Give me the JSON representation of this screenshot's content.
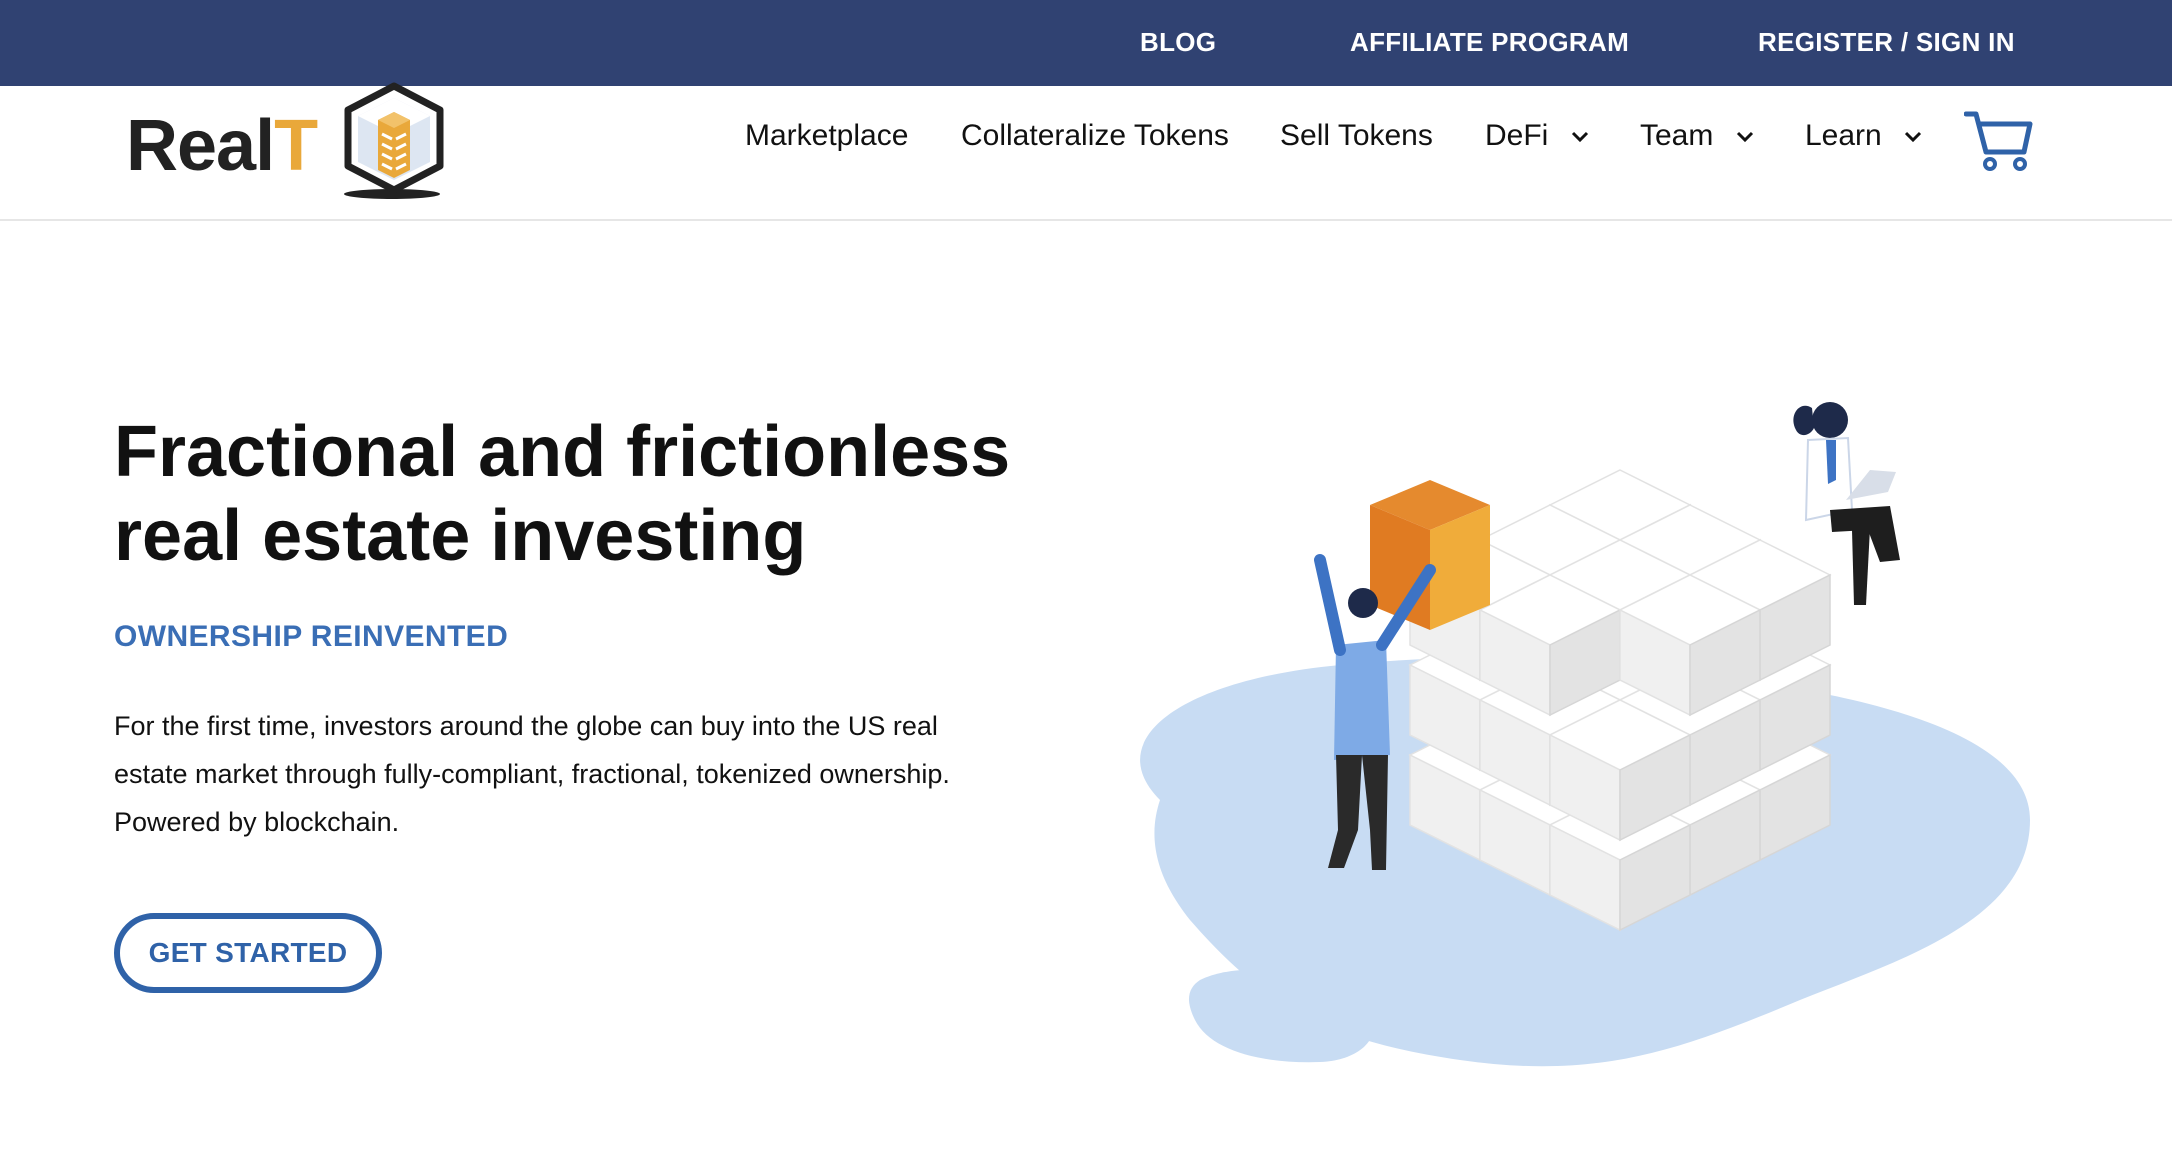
{
  "topbar": {
    "blog": "BLOG",
    "affiliate": "AFFILIATE PROGRAM",
    "register": "REGISTER / SIGN IN"
  },
  "logo": {
    "part1": "Real",
    "part2": "T"
  },
  "nav": {
    "marketplace": "Marketplace",
    "collateralize": "Collateralize Tokens",
    "sell": "Sell Tokens",
    "defi": "DeFi",
    "team": "Team",
    "learn": "Learn"
  },
  "icons": {
    "cart": "cart-icon",
    "chevron": "chevron-down-icon"
  },
  "hero": {
    "title_line1": "Fractional and frictionless",
    "title_line2": "real estate investing",
    "subtitle": "OWNERSHIP REINVENTED",
    "description_line1": "For the first time, investors around the globe can buy into the US real",
    "description_line2": "estate market through fully-compliant, fractional, tokenized ownership.",
    "description_line3": "Powered by blockchain.",
    "cta": "GET STARTED"
  },
  "colors": {
    "topbar_bg": "#304272",
    "accent_blue": "#2f62a8",
    "subtitle_blue": "#3a6eb5",
    "logo_gold": "#e9a83a",
    "blob_blue": "#c8dcf3"
  }
}
